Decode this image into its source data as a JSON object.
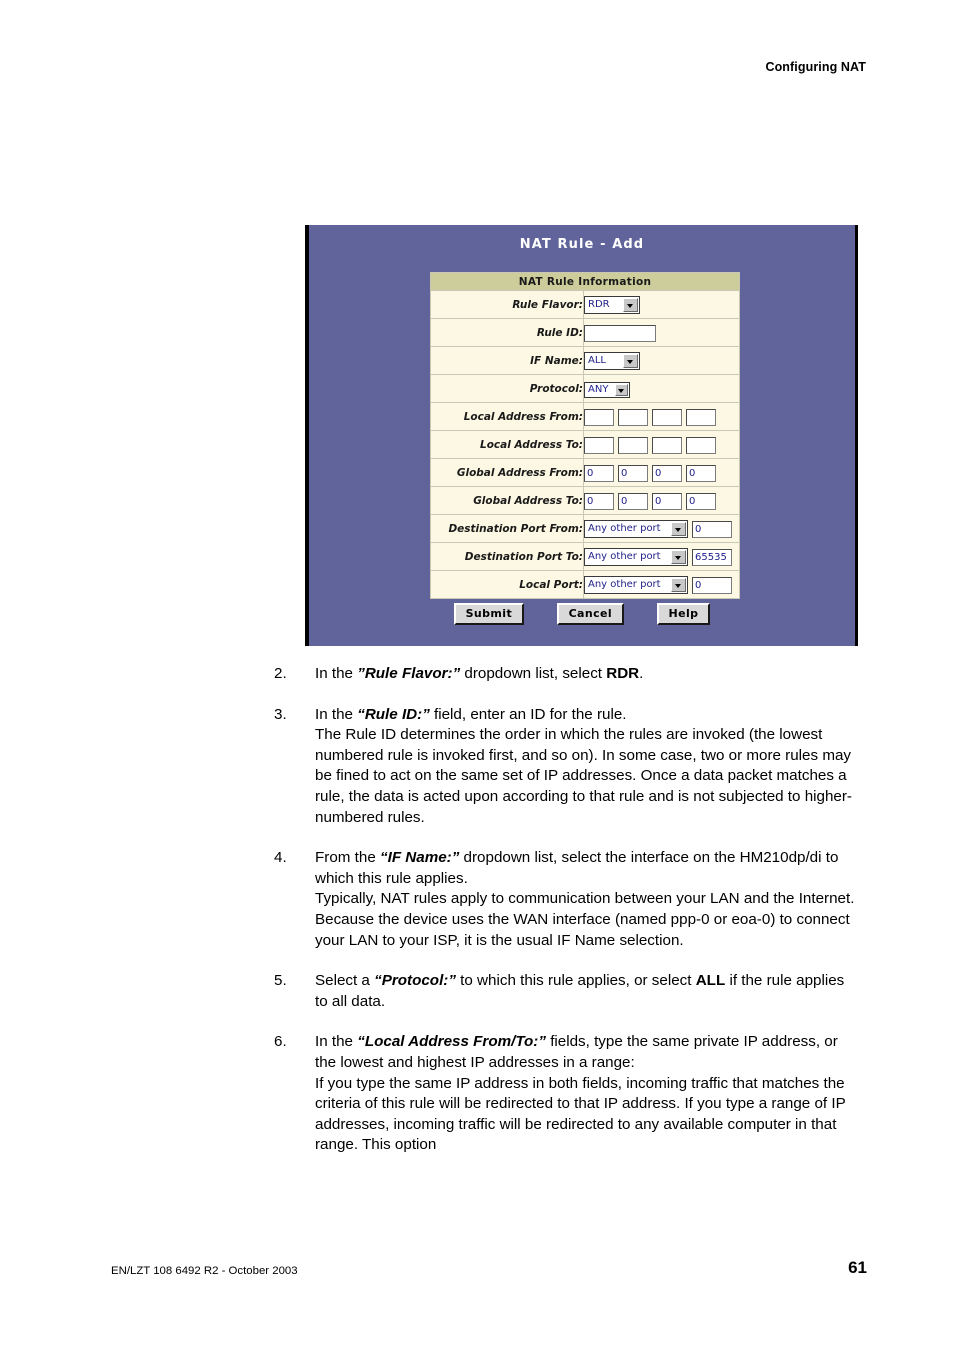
{
  "page": {
    "header": "Configuring NAT",
    "footer_left": "EN/LZT 108 6492 R2 - October 2003",
    "footer_page": "61"
  },
  "screenshot": {
    "title": "NAT Rule - Add",
    "panel_color": "#61649b",
    "table_header": "NAT Rule Information",
    "header_bg": "#cdcd9b",
    "row_bg": "#fdf8e3",
    "rows": [
      {
        "label": "Rule Flavor:",
        "type": "select",
        "value": "RDR"
      },
      {
        "label": "Rule ID:",
        "type": "text",
        "value": ""
      },
      {
        "label": "IF Name:",
        "type": "select",
        "value": "ALL"
      },
      {
        "label": "Protocol:",
        "type": "select",
        "value": "ANY"
      },
      {
        "label": "Local Address From:",
        "type": "ip",
        "octets": [
          "",
          "",
          "",
          ""
        ]
      },
      {
        "label": "Local Address To:",
        "type": "ip",
        "octets": [
          "",
          "",
          "",
          ""
        ]
      },
      {
        "label": "Global Address From:",
        "type": "ip",
        "octets": [
          "0",
          "0",
          "0",
          "0"
        ]
      },
      {
        "label": "Global Address To:",
        "type": "ip",
        "octets": [
          "0",
          "0",
          "0",
          "0"
        ]
      },
      {
        "label": "Destination Port From:",
        "type": "port",
        "kind": "Any other port",
        "value": "0"
      },
      {
        "label": "Destination Port To:",
        "type": "port",
        "kind": "Any other port",
        "value": "65535"
      },
      {
        "label": "Local Port:",
        "type": "port",
        "kind": "Any other port",
        "value": "0"
      }
    ],
    "buttons": {
      "submit": "Submit",
      "cancel": "Cancel",
      "help": "Help"
    }
  },
  "steps": [
    {
      "num": "2.",
      "lead_pre": "In the ",
      "term": "”Rule Flavor:”",
      "lead_post": " dropdown list, select ",
      "strong": "RDR",
      "lead_end": ".",
      "body": ""
    },
    {
      "num": "3.",
      "lead_pre": "In the ",
      "term": "“Rule ID:”",
      "lead_post": " field, enter an ID for the rule.",
      "strong": "",
      "lead_end": "",
      "body": "The Rule ID determines the order in which the rules are invoked (the lowest numbered rule is invoked first, and so on). In some case, two or more rules may be fined to act on the same set of IP addresses. Once a data packet matches a rule, the data is acted upon according to that rule and is not subjected to higher-numbered rules."
    },
    {
      "num": "4.",
      "lead_pre": "From the ",
      "term": "“IF Name:”",
      "lead_post": " dropdown list, select the interface on the HM210dp/di to which this rule applies.",
      "strong": "",
      "lead_end": "",
      "body": "Typically, NAT rules apply to communication between your LAN and the Internet. Because the device uses the WAN interface (named ppp-0 or eoa-0) to connect your LAN to your ISP, it is the usual IF Name selection."
    },
    {
      "num": "5.",
      "lead_pre": "Select a ",
      "term": "“Protocol:”",
      "lead_post": " to which this rule applies, or select ",
      "strong": "ALL",
      "lead_end": " if the rule applies to all data.",
      "body": ""
    },
    {
      "num": "6.",
      "lead_pre": "In the ",
      "term": "“Local Address From/To:”",
      "lead_post": " fields, type the same private IP address, or the lowest and highest IP addresses in a range:",
      "strong": "",
      "lead_end": "",
      "body": "If you type the same IP address in both fields, incoming traffic that matches the criteria of this rule will be redirected to that IP address. If you type a range of IP addresses, incoming traffic will be redirected to any available computer in that range. This option"
    }
  ]
}
